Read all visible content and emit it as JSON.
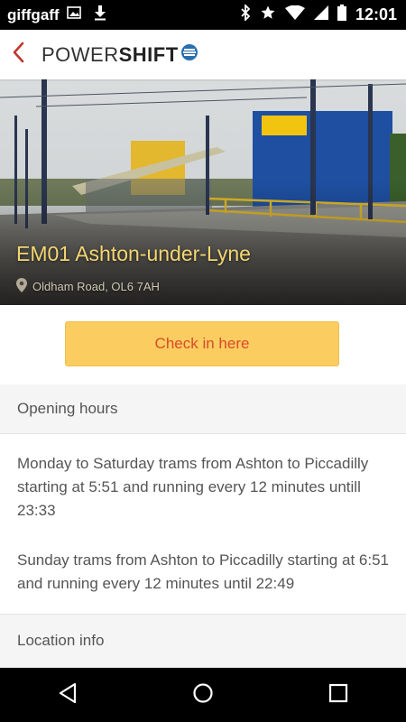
{
  "status_bar": {
    "carrier": "giffgaff",
    "time": "12:01",
    "icons": [
      "image-icon",
      "download-icon",
      "bluetooth-icon",
      "star-icon",
      "wifi-icon",
      "signal-icon",
      "battery-icon"
    ]
  },
  "app_bar": {
    "back_icon": "chevron-left-icon",
    "logo_part1": "POWER",
    "logo_part2": "SHIFT",
    "accent_color": "#c0392b"
  },
  "hero": {
    "title": "EM01 Ashton-under-Lyne",
    "address": "Oldham Road, OL6 7AH",
    "image_description_icon": "location-pin-icon"
  },
  "checkin": {
    "label": "Check in here",
    "button_color": "#fbcd60",
    "text_color": "#d94a2a"
  },
  "sections": {
    "opening_hours": {
      "title": "Opening hours",
      "paragraphs": [
        "Monday to Saturday trams from Ashton to Piccadilly starting at 5:51 and running every 12 minutes untill 23:33",
        "Sunday trams from Ashton to Piccadilly starting at 6:51 and running every 12 minutes until 22:49"
      ]
    },
    "location_info": {
      "title": "Location info"
    }
  },
  "nav_bar": {
    "back": "back-triangle-icon",
    "home": "home-circle-icon",
    "recents": "recents-square-icon"
  }
}
